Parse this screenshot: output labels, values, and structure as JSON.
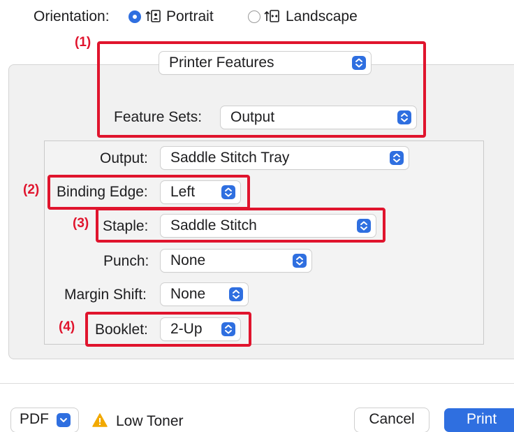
{
  "orientation": {
    "label": "Orientation:",
    "options": [
      {
        "label": "Portrait",
        "selected": true
      },
      {
        "label": "Landscape",
        "selected": false
      }
    ]
  },
  "panel_menu": {
    "value": "Printer Features"
  },
  "feature_sets": {
    "label": "Feature Sets:",
    "value": "Output"
  },
  "fields": {
    "output": {
      "label": "Output:",
      "value": "Saddle Stitch Tray"
    },
    "binding_edge": {
      "label": "Binding Edge:",
      "value": "Left"
    },
    "staple": {
      "label": "Staple:",
      "value": "Saddle Stitch"
    },
    "punch": {
      "label": "Punch:",
      "value": "None"
    },
    "margin_shift": {
      "label": "Margin Shift:",
      "value": "None"
    },
    "booklet": {
      "label": "Booklet:",
      "value": "2-Up"
    }
  },
  "callouts": [
    "(1)",
    "(2)",
    "(3)",
    "(4)"
  ],
  "footer": {
    "pdf_label": "PDF",
    "warning_text": "Low Toner",
    "cancel_label": "Cancel",
    "print_label": "Print"
  },
  "colors": {
    "accent": "#2f6fe0",
    "highlight": "#e0142d",
    "warning": "#f2a900"
  },
  "icons": [
    "radio-selected",
    "radio-unselected",
    "portrait-icon",
    "landscape-icon",
    "popup-arrows-icon",
    "chevron-down-icon",
    "warning-icon"
  ]
}
